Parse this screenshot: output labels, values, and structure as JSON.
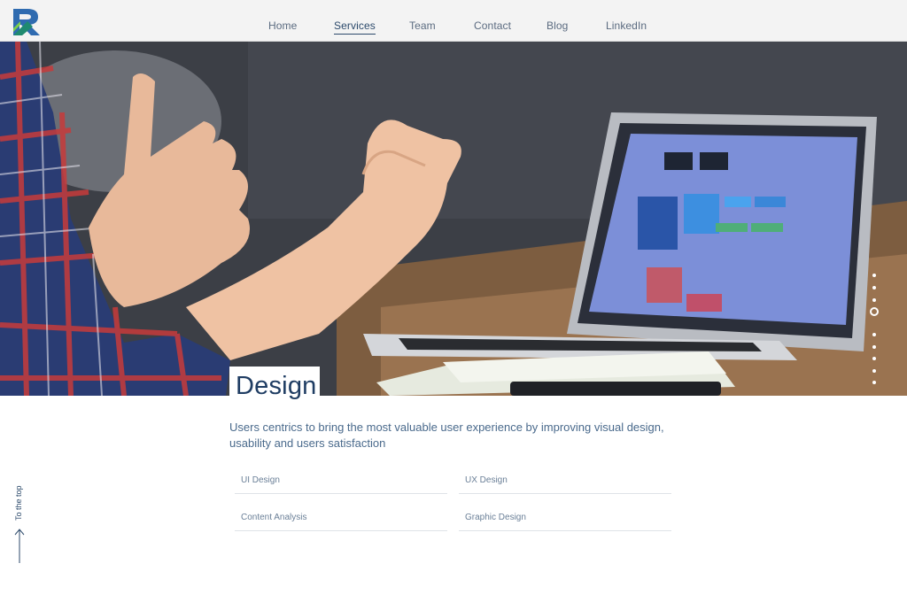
{
  "nav": {
    "items": [
      {
        "label": "Home"
      },
      {
        "label": "Services"
      },
      {
        "label": "Team"
      },
      {
        "label": "Contact"
      },
      {
        "label": "Blog"
      },
      {
        "label": "LinkedIn"
      }
    ],
    "active": "Services"
  },
  "logo": {
    "icon": "r-logo-icon",
    "colors": [
      "#1f8a70",
      "#2f6bb0",
      "#7ccf4a"
    ]
  },
  "hero": {
    "image": "meeting-laptop-photo",
    "slide_count": 10,
    "active_slide": 3
  },
  "service": {
    "title": "Design",
    "description": "Users centrics to bring the most valuable user experience by improving visual design, usability and users satisfaction",
    "items": [
      {
        "label": "UI Design"
      },
      {
        "label": "UX Design"
      },
      {
        "label": "Content Analysis"
      },
      {
        "label": "Graphic Design"
      }
    ]
  },
  "to_top": {
    "label": "To the top",
    "icon": "arrow-up-icon"
  },
  "colors": {
    "primary": "#1f3d63",
    "text": "#4a6a8c",
    "header_bg": "#f3f3f3"
  }
}
